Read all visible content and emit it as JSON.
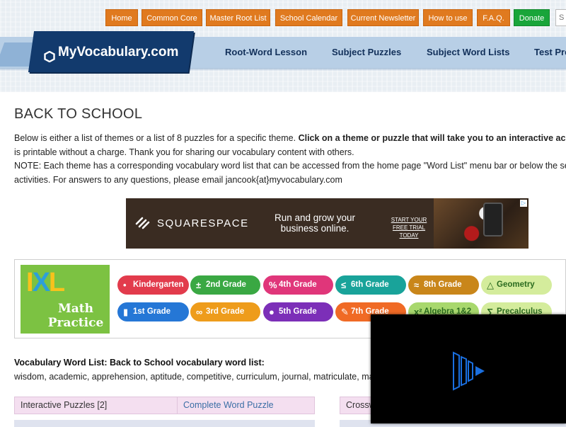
{
  "top_nav": {
    "items": [
      "Home",
      "Common Core",
      "Master Root List",
      "School Calendar",
      "Current Newsletter",
      "How to use",
      "F.A.Q.",
      "Donate"
    ],
    "search_placeholder": "S"
  },
  "logo": {
    "text": "MyVocabulary.com"
  },
  "main_nav": {
    "items": [
      "Root-Word Lesson",
      "Subject Puzzles",
      "Subject Word Lists",
      "Test Pre"
    ]
  },
  "page": {
    "title": "BACK TO SCHOOL",
    "intro_line1_plain": "Below is either a list of themes or a list of 8 puzzles for a specific theme. ",
    "intro_line1_bold": "Click on a theme or puzzle that will take you to an interactive ac",
    "intro_line2": "is printable without a charge. Thank you for sharing our vocabulary content with others.",
    "note_line1": "NOTE: Each theme has a corresponding vocabulary word list that can be accessed from the home page \"Word List\" menu bar or below the se",
    "note_line2": "activities. For answers to any questions, please email jancook{at}myvocabulary.com"
  },
  "ad_squarespace": {
    "brand": "SQUARESPACE",
    "tagline": "Run and grow your business online.",
    "cta": "START YOUR FREE TRIAL TODAY"
  },
  "ad_ixl": {
    "logo": "IXL",
    "subtitle": "Math Practice",
    "pills": [
      {
        "label": "Kindergarten",
        "icon": "•",
        "color": "#e23b4c"
      },
      {
        "label": "2nd Grade",
        "icon": "±",
        "color": "#3aa843"
      },
      {
        "label": "4th Grade",
        "icon": "%",
        "color": "#e0367a"
      },
      {
        "label": "6th Grade",
        "icon": "≤",
        "color": "#19a39a"
      },
      {
        "label": "8th Grade",
        "icon": "≈",
        "color": "#c9861a"
      },
      {
        "label": "Geometry",
        "icon": "△",
        "color": "#d4ec9c"
      },
      {
        "label": "1st Grade",
        "icon": "▮",
        "color": "#2577d6"
      },
      {
        "label": "3rd Grade",
        "icon": "∞",
        "color": "#ee9c1b"
      },
      {
        "label": "5th Grade",
        "icon": "●",
        "color": "#7c2fb8"
      },
      {
        "label": "7th Grade",
        "icon": "✎",
        "color": "#f06a25"
      },
      {
        "label": "Algebra 1&2",
        "icon": "x²",
        "color": "#a8d86d"
      },
      {
        "label": "Precalculus",
        "icon": "∑",
        "color": "#d4ec9c"
      }
    ]
  },
  "word_list": {
    "heading": "Vocabulary Word List: Back to School vocabulary word list:",
    "words": "wisdom, academic, apprehension, aptitude, competitive, curriculum, journal, matriculate, ma"
  },
  "table": {
    "left_label": "Interactive Puzzles [2]",
    "left_link": "Complete Word Puzzle",
    "right_label": "Crossw"
  }
}
